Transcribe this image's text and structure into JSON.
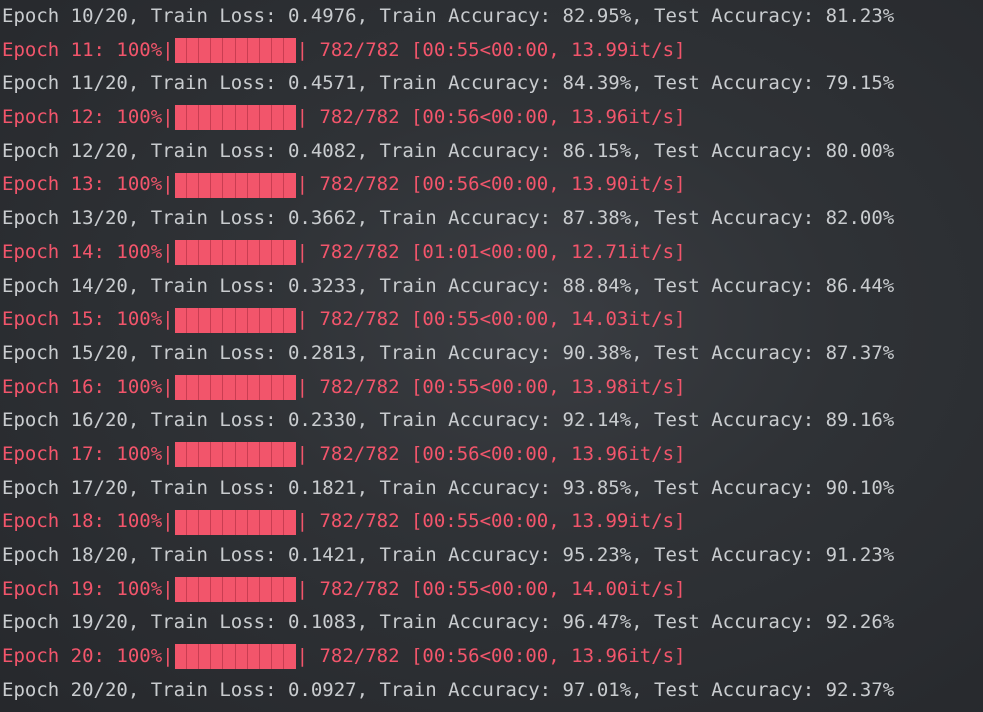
{
  "terminal": {
    "progress_color": "#f2556b",
    "lines": [
      {
        "type": "metrics",
        "text": "Epoch 10/20, Train Loss: 0.4976, Train Accuracy: 82.95%, Test Accuracy: 81.23%"
      },
      {
        "type": "progress",
        "prefix": "Epoch 11: 100%|",
        "suffix": "| 782/782 [00:55<00:00, 13.99it/s]",
        "progress": 1.0
      },
      {
        "type": "metrics",
        "text": "Epoch 11/20, Train Loss: 0.4571, Train Accuracy: 84.39%, Test Accuracy: 79.15%"
      },
      {
        "type": "progress",
        "prefix": "Epoch 12: 100%|",
        "suffix": "| 782/782 [00:56<00:00, 13.96it/s]",
        "progress": 1.0
      },
      {
        "type": "metrics",
        "text": "Epoch 12/20, Train Loss: 0.4082, Train Accuracy: 86.15%, Test Accuracy: 80.00%"
      },
      {
        "type": "progress",
        "prefix": "Epoch 13: 100%|",
        "suffix": "| 782/782 [00:56<00:00, 13.90it/s]",
        "progress": 1.0
      },
      {
        "type": "metrics",
        "text": "Epoch 13/20, Train Loss: 0.3662, Train Accuracy: 87.38%, Test Accuracy: 82.00%"
      },
      {
        "type": "progress",
        "prefix": "Epoch 14: 100%|",
        "suffix": "| 782/782 [01:01<00:00, 12.71it/s]",
        "progress": 1.0
      },
      {
        "type": "metrics",
        "text": "Epoch 14/20, Train Loss: 0.3233, Train Accuracy: 88.84%, Test Accuracy: 86.44%"
      },
      {
        "type": "progress",
        "prefix": "Epoch 15: 100%|",
        "suffix": "| 782/782 [00:55<00:00, 14.03it/s]",
        "progress": 1.0
      },
      {
        "type": "metrics",
        "text": "Epoch 15/20, Train Loss: 0.2813, Train Accuracy: 90.38%, Test Accuracy: 87.37%"
      },
      {
        "type": "progress",
        "prefix": "Epoch 16: 100%|",
        "suffix": "| 782/782 [00:55<00:00, 13.98it/s]",
        "progress": 1.0
      },
      {
        "type": "metrics",
        "text": "Epoch 16/20, Train Loss: 0.2330, Train Accuracy: 92.14%, Test Accuracy: 89.16%"
      },
      {
        "type": "progress",
        "prefix": "Epoch 17: 100%|",
        "suffix": "| 782/782 [00:56<00:00, 13.96it/s]",
        "progress": 1.0
      },
      {
        "type": "metrics",
        "text": "Epoch 17/20, Train Loss: 0.1821, Train Accuracy: 93.85%, Test Accuracy: 90.10%"
      },
      {
        "type": "progress",
        "prefix": "Epoch 18: 100%|",
        "suffix": "| 782/782 [00:55<00:00, 13.99it/s]",
        "progress": 1.0
      },
      {
        "type": "metrics",
        "text": "Epoch 18/20, Train Loss: 0.1421, Train Accuracy: 95.23%, Test Accuracy: 91.23%"
      },
      {
        "type": "progress",
        "prefix": "Epoch 19: 100%|",
        "suffix": "| 782/782 [00:55<00:00, 14.00it/s]",
        "progress": 1.0
      },
      {
        "type": "metrics",
        "text": "Epoch 19/20, Train Loss: 0.1083, Train Accuracy: 96.47%, Test Accuracy: 92.26%"
      },
      {
        "type": "progress",
        "prefix": "Epoch 20: 100%|",
        "suffix": "| 782/782 [00:56<00:00, 13.96it/s]",
        "progress": 1.0
      },
      {
        "type": "metrics",
        "text": "Epoch 20/20, Train Loss: 0.0927, Train Accuracy: 97.01%, Test Accuracy: 92.37%"
      }
    ]
  }
}
